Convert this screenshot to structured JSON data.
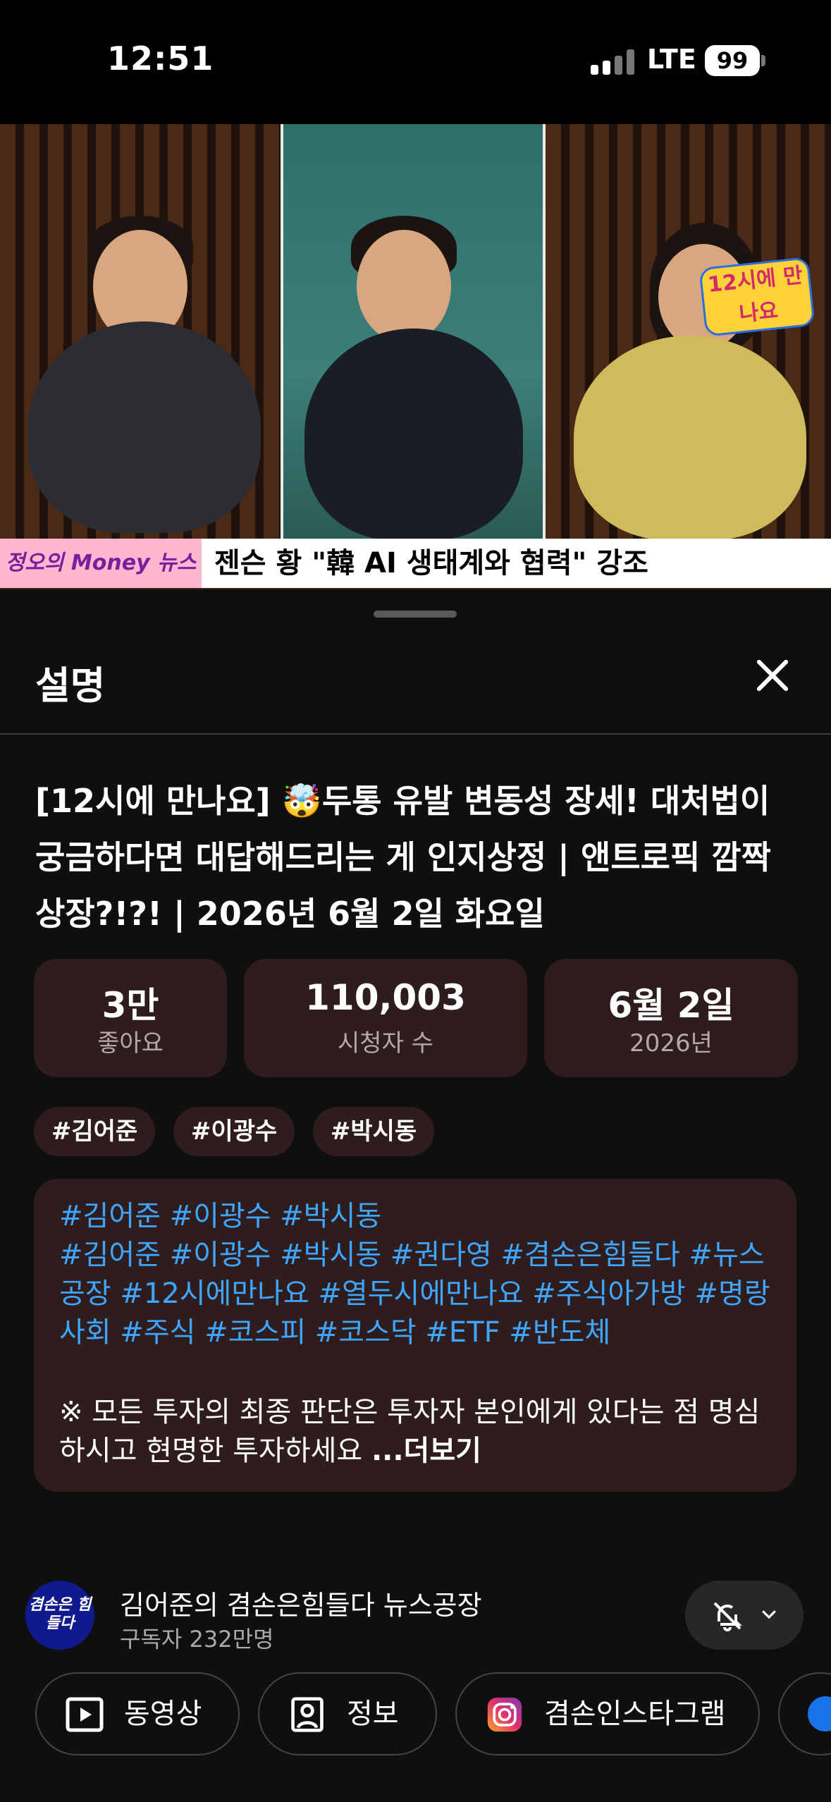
{
  "status": {
    "time": "12:51",
    "network": "LTE",
    "battery": "99"
  },
  "video": {
    "ticker_tag": "정오의 Money 뉴스",
    "ticker_text": "젠슨 황 \"韓 AI 생태계와 협력\" 강조",
    "show_logo": "12시에 만나요"
  },
  "sheet": {
    "title": "설명",
    "video_title": "[12시에 만나요] 🤯두통 유발 변동성 장세! 대처법이 궁금하다면 대답해드리는 게 인지상정 | 앤트로픽 깜짝 상장?!?! | 2026년 6월 2일 화요일",
    "stats": [
      {
        "value": "3만",
        "label": "좋아요"
      },
      {
        "value": "110,003",
        "label": "시청자 수"
      },
      {
        "value": "6월 2일",
        "label": "2026년"
      }
    ],
    "tags": [
      "#김어준",
      "#이광수",
      "#박시동"
    ],
    "description": {
      "tags_line1": "#김어준 #이광수 #박시동",
      "tags_line2": "#김어준 #이광수 #박시동 #권다영 #겸손은힘들다 #뉴스공장 #12시에만나요 #열두시에만나요 #주식아가방 #명랑사회 #주식 #코스피 #코스닥 #ETF #반도체",
      "note": "※ 모든 투자의 최종 판단은 투자자 본인에게 있다는 점 명심하시고 현명한 투자하세요 ",
      "more": "...더보기"
    },
    "channel": {
      "avatar_text": "겸손은 힘들다",
      "name": "김어준의 겸손은힘들다 뉴스공장",
      "subscribers": "구독자 232만명"
    },
    "links": [
      {
        "label": "동영상",
        "icon": "video-icon"
      },
      {
        "label": "정보",
        "icon": "profile-icon"
      },
      {
        "label": "겸손인스타그램",
        "icon": "instagram-icon"
      }
    ]
  },
  "colors": {
    "hashtag": "#3ea6ff",
    "chip_bg": "#2f1c1c",
    "sheet_bg": "#0f0f0f"
  }
}
